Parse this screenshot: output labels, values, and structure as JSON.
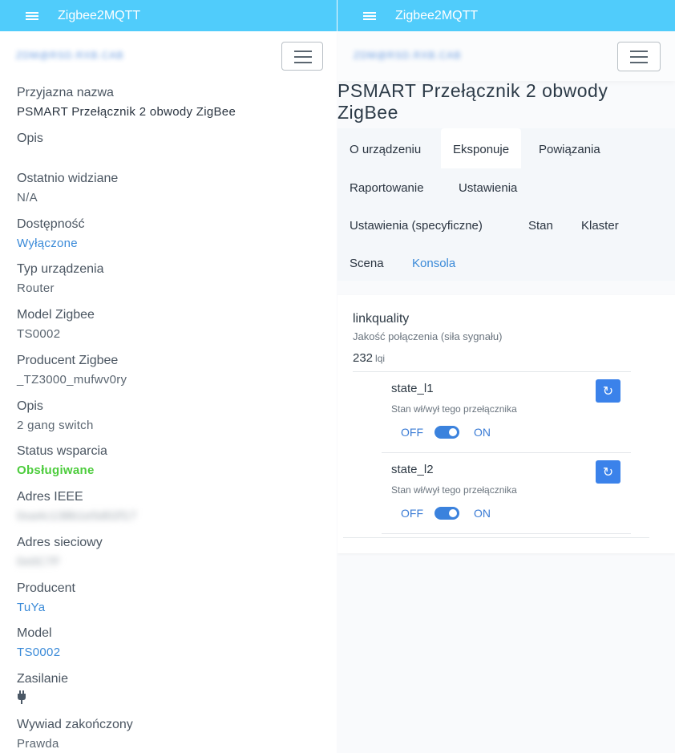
{
  "app": {
    "title": "Zigbee2MQTT"
  },
  "left": {
    "blurred_address": "ZDM@RSD.RXB.CAB",
    "fields": [
      {
        "label": "Przyjazna nazwa",
        "value": "PSMART Przełącznik 2 obwody ZigBee"
      },
      {
        "label": "Opis",
        "value": ""
      },
      {
        "label": "Ostatnio widziane",
        "value": "N/A"
      },
      {
        "label": "Dostępność",
        "value": "Wyłączone"
      },
      {
        "label": "Typ urządzenia",
        "value": "Router"
      },
      {
        "label": "Model Zigbee",
        "value": "TS0002"
      },
      {
        "label": "Producent Zigbee",
        "value": "_TZ3000_mufwv0ry"
      },
      {
        "label": "Opis",
        "value": "2 gang switch"
      },
      {
        "label": "Status wsparcia",
        "value": "Obsługiwane"
      },
      {
        "label": "Adres IEEE",
        "value": "0xa4c138b1e5d02f17"
      },
      {
        "label": "Adres sieciowy",
        "value": "0x0C7F"
      },
      {
        "label": "Producent",
        "value": "TuYa"
      },
      {
        "label": "Model",
        "value": "TS0002"
      },
      {
        "label": "Zasilanie",
        "icon": "power-plug-icon"
      },
      {
        "label": "Wywiad zakończony",
        "value": "Prawda"
      }
    ]
  },
  "right": {
    "blurred_address": "ZDM@RSD.RXB.CAB",
    "device_title": "PSMART Przełącznik 2 obwody ZigBee",
    "tabs": [
      {
        "label": "O urządzeniu"
      },
      {
        "label": "Eksponuje"
      },
      {
        "label": "Powiązania"
      },
      {
        "label": "Raportowanie"
      },
      {
        "label": "Ustawienia"
      },
      {
        "label": "Ustawienia (specyficzne)"
      },
      {
        "label": "Stan"
      },
      {
        "label": "Klaster"
      },
      {
        "label": "Scena"
      },
      {
        "label": "Konsola"
      }
    ],
    "linkquality": {
      "name": "linkquality",
      "description": "Jakość połączenia (siła sygnału)",
      "value": "232",
      "unit": "lqi"
    },
    "switches": [
      {
        "name": "state_l1",
        "description": "Stan wł/wył tego przełącznika",
        "off_label": "OFF",
        "on_label": "ON",
        "state": "ON"
      },
      {
        "name": "state_l2",
        "description": "Stan wł/wył tego przełącznika",
        "off_label": "OFF",
        "on_label": "ON",
        "state": "ON"
      }
    ]
  },
  "colors": {
    "topbar": "#50ccfb",
    "link": "#3a8ad8",
    "supported": "#4ccc3c",
    "toggle": "#3b82dd"
  }
}
